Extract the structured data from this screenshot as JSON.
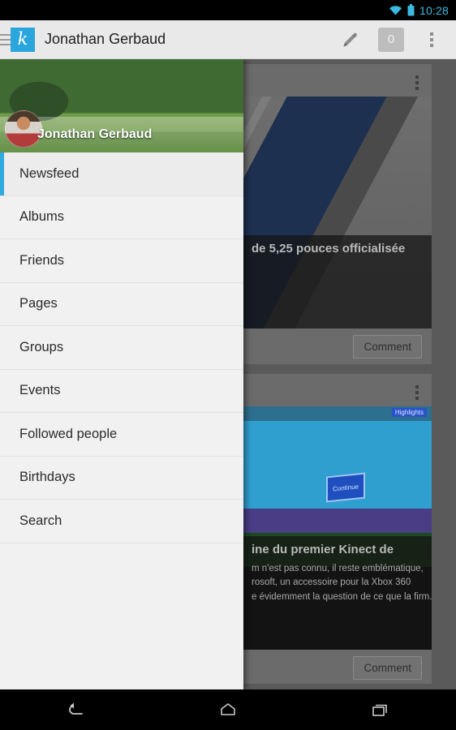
{
  "status_bar": {
    "time": "10:28",
    "time_color": "#3bb9e0",
    "wifi_icon": "wifi-icon",
    "battery_icon": "battery-icon"
  },
  "action_bar": {
    "menu_icon": "hamburger-icon",
    "logo_letter": "k",
    "logo_color": "#2ba6dd",
    "title": "Jonathan Gerbaud",
    "compose_icon": "pencil-icon",
    "notification_count": "0",
    "overflow_icon": "overflow-menu-icon"
  },
  "drawer": {
    "profile_name": "Jonathan Gerbaud",
    "avatar_icon": "profile-avatar",
    "cover_photo_icon": "cover-photo",
    "accent_color": "#2fabe0",
    "items": [
      {
        "label": "Newsfeed",
        "selected": true
      },
      {
        "label": "Albums",
        "selected": false
      },
      {
        "label": "Friends",
        "selected": false
      },
      {
        "label": "Pages",
        "selected": false
      },
      {
        "label": "Groups",
        "selected": false
      },
      {
        "label": "Events",
        "selected": false
      },
      {
        "label": "Followed people",
        "selected": false
      },
      {
        "label": "Birthdays",
        "selected": false
      },
      {
        "label": "Search",
        "selected": false
      }
    ]
  },
  "feed": {
    "cards": [
      {
        "overflow_icon": "overflow-menu-icon",
        "image_icon": "samsung-phone-photo",
        "caption_title": "de 5,25 pouces officialisée",
        "caption_body": "",
        "comment_label": "Comment"
      },
      {
        "overflow_icon": "overflow-menu-icon",
        "image_icon": "kinect-xbox-photo",
        "caption_title": "ine du premier Kinect de",
        "caption_body_line1": "m n'est pas connu, il reste emblématique,",
        "caption_body_line2": "rosoft, un accessoire pour la Xbox 360",
        "caption_body_line3": "e évidemment la question de ce que la firm...",
        "comment_label": "Comment"
      }
    ]
  },
  "nav_bar": {
    "back_icon": "back-arrow-icon",
    "home_icon": "home-icon",
    "recents_icon": "recent-apps-icon"
  }
}
